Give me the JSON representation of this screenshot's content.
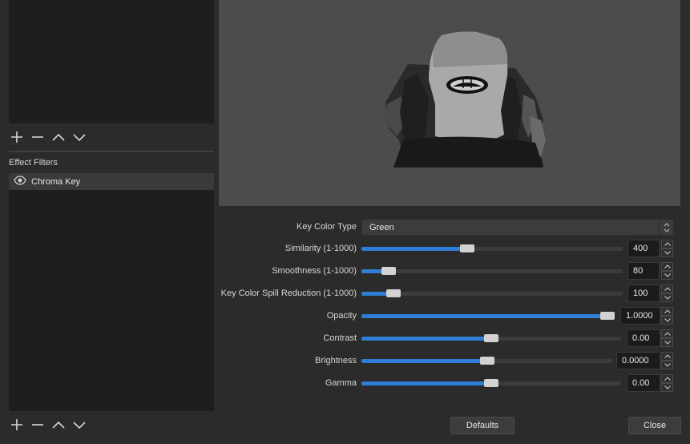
{
  "sources_panel": {
    "toolbar": [
      "add",
      "remove",
      "move-up",
      "move-down"
    ]
  },
  "filters_panel": {
    "section_label": "Effect Filters",
    "items": [
      {
        "label": "Chroma Key",
        "visible": true
      }
    ]
  },
  "properties": {
    "key_color_type": {
      "label": "Key Color Type",
      "value": "Green"
    },
    "sliders": [
      {
        "id": "similarity",
        "label": "Similarity (1-1000)",
        "value": "400",
        "fraction": 0.4
      },
      {
        "id": "smoothness",
        "label": "Smoothness (1-1000)",
        "value": "80",
        "fraction": 0.08
      },
      {
        "id": "spill",
        "label": "Key Color Spill Reduction (1-1000)",
        "value": "100",
        "fraction": 0.1
      },
      {
        "id": "opacity",
        "label": "Opacity",
        "value": "1.0000",
        "fraction": 1.0
      },
      {
        "id": "contrast",
        "label": "Contrast",
        "value": "0.00",
        "fraction": 0.5
      },
      {
        "id": "brightness",
        "label": "Brightness",
        "value": "0.0000",
        "fraction": 0.5
      },
      {
        "id": "gamma",
        "label": "Gamma",
        "value": "0.00",
        "fraction": 0.5
      }
    ]
  },
  "buttons": {
    "defaults": "Defaults",
    "close": "Close"
  },
  "colors": {
    "accent": "#2f7dd6",
    "background": "#2b2b2b",
    "panel": "#1e1e1e",
    "preview": "#4c4c4c"
  }
}
